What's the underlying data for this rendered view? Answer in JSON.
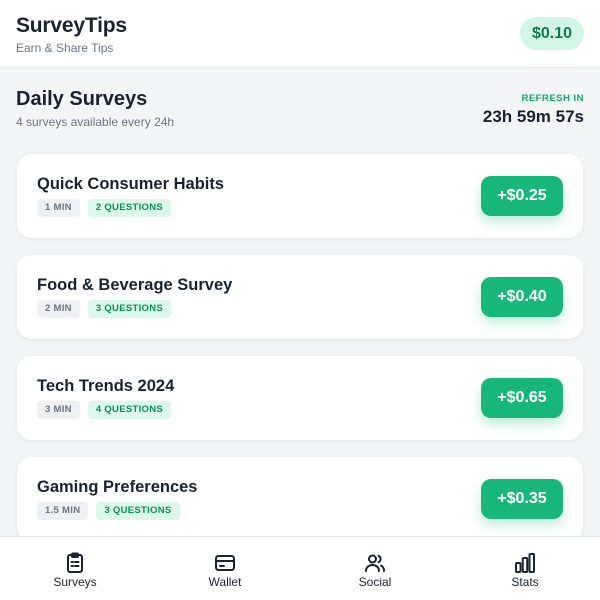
{
  "header": {
    "title": "SurveyTips",
    "subtitle": "Earn & Share Tips",
    "balance": "$0.10"
  },
  "section": {
    "title": "Daily Surveys",
    "subtitle": "4 surveys available every 24h",
    "refresh_label": "REFRESH IN",
    "refresh_time": "23h 59m 57s"
  },
  "surveys": [
    {
      "title": "Quick Consumer Habits",
      "duration": "1 MIN",
      "questions": "2 QUESTIONS",
      "reward": "+$0.25"
    },
    {
      "title": "Food & Beverage Survey",
      "duration": "2 MIN",
      "questions": "3 QUESTIONS",
      "reward": "+$0.40"
    },
    {
      "title": "Tech Trends 2024",
      "duration": "3 MIN",
      "questions": "4 QUESTIONS",
      "reward": "+$0.65"
    },
    {
      "title": "Gaming Preferences",
      "duration": "1.5 MIN",
      "questions": "3 QUESTIONS",
      "reward": "+$0.35"
    }
  ],
  "nav": [
    {
      "label": "Surveys",
      "icon": "clipboard-icon"
    },
    {
      "label": "Wallet",
      "icon": "wallet-icon"
    },
    {
      "label": "Social",
      "icon": "users-icon"
    },
    {
      "label": "Stats",
      "icon": "bar-chart-icon"
    }
  ],
  "colors": {
    "accent": "#19b67a",
    "accent_light": "#d3f5e6",
    "text_primary": "#1a2230",
    "text_muted": "#6b7480",
    "background": "#f3f5f7"
  }
}
